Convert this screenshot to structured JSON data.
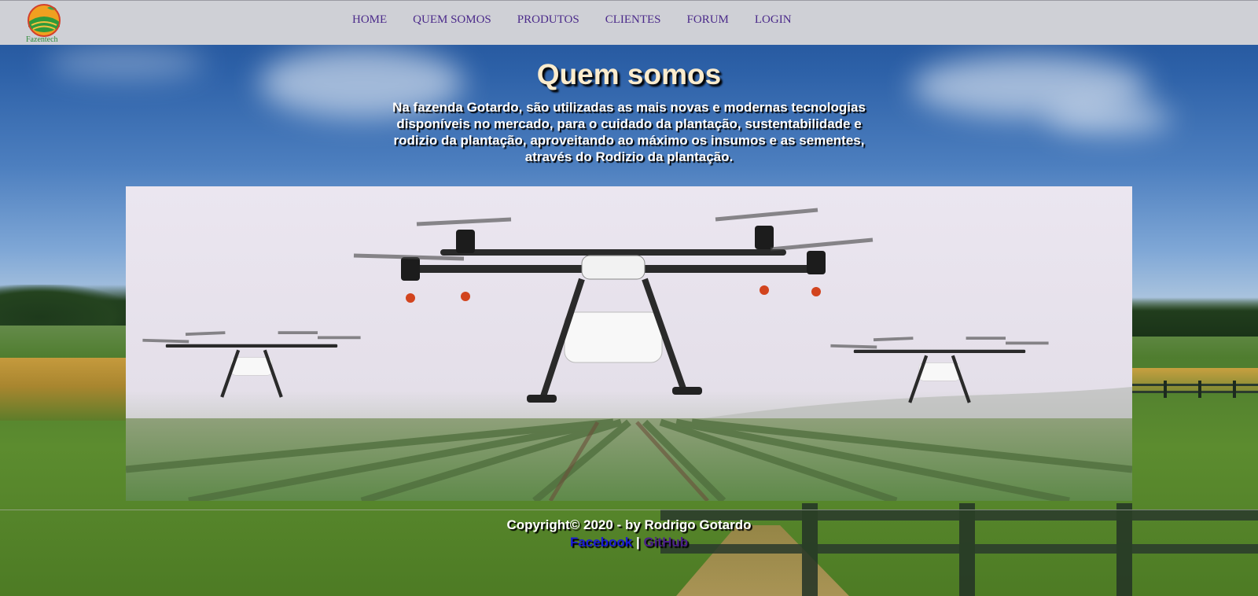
{
  "brand": {
    "logo_text": "Fazentech"
  },
  "nav": {
    "items": [
      {
        "label": "HOME"
      },
      {
        "label": "QUEM SOMOS"
      },
      {
        "label": "PRODUTOS"
      },
      {
        "label": "CLIENTES"
      },
      {
        "label": "FORUM"
      },
      {
        "label": "LOGIN"
      }
    ]
  },
  "hero": {
    "title": "Quem somos",
    "text": "Na fazenda Gotardo, são utilizadas as mais novas e modernas tecnologias disponíveis no mercado, para o cuidado da plantação, sustentabilidade e rodizio da plantação, aproveitando ao máximo os insumos e as sementes, através do Rodizio da plantação."
  },
  "media": {
    "image_icon": "drone-fleet-image"
  },
  "footer": {
    "copyright": "Copyright© 2020 - by Rodrigo Gotardo",
    "facebook": "Facebook",
    "separator": "|",
    "github": "GitHub"
  },
  "colors": {
    "navbar_bg": "#cfd0d6",
    "nav_link": "#4b2a8a",
    "title": "#fbeccd",
    "facebook_link": "#1a1ad6",
    "github_link": "#4b1f8a"
  }
}
